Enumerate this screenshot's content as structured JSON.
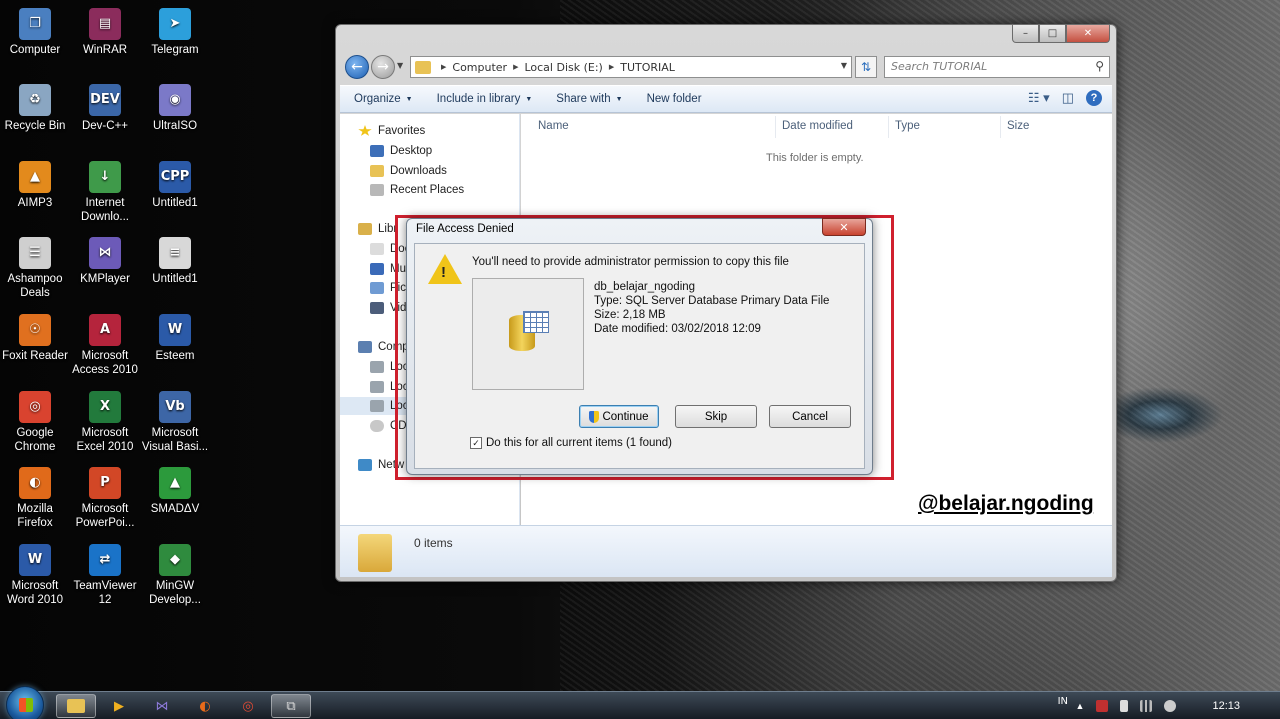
{
  "desktop": {
    "icons": [
      {
        "label": "Computer",
        "icon": "computer-icon",
        "color": "#4a7fc0",
        "glyph": "❐"
      },
      {
        "label": "WinRAR",
        "icon": "winrar-icon",
        "color": "#8b2c5c",
        "glyph": "▤"
      },
      {
        "label": "Telegram",
        "icon": "telegram-icon",
        "color": "#2c9fdb",
        "glyph": "➤"
      },
      {
        "label": "Recycle Bin",
        "icon": "recycle-bin-icon",
        "color": "#8aa6c2",
        "glyph": "♻"
      },
      {
        "label": "Dev-C++",
        "icon": "devcpp-icon",
        "color": "#3b67a8",
        "glyph": "DEV"
      },
      {
        "label": "UltraISO",
        "icon": "ultraiso-icon",
        "color": "#7b79c8",
        "glyph": "◉"
      },
      {
        "label": "AIMP3",
        "icon": "aimp-icon",
        "color": "#e38a1c",
        "glyph": "▲"
      },
      {
        "label": "Internet\nDownlo...",
        "icon": "idm-icon",
        "color": "#3f9a4a",
        "glyph": "↓"
      },
      {
        "label": "Untitled1",
        "icon": "cpp-file-icon",
        "color": "#2b5aa8",
        "glyph": "CPP"
      },
      {
        "label": "Ashampoo\nDeals",
        "icon": "ashampoo-icon",
        "color": "#cfcfcf",
        "glyph": "☰"
      },
      {
        "label": "KMPlayer",
        "icon": "kmplayer-icon",
        "color": "#6c5ab8",
        "glyph": "⋈"
      },
      {
        "label": "Untitled1",
        "icon": "document-icon",
        "color": "#d8d8d8",
        "glyph": "≡"
      },
      {
        "label": "Foxit Reader",
        "icon": "foxit-icon",
        "color": "#e0701f",
        "glyph": "☉"
      },
      {
        "label": "Microsoft\nAccess 2010",
        "icon": "access-icon",
        "color": "#b5243c",
        "glyph": "A"
      },
      {
        "label": "Esteem",
        "icon": "word-doc-icon",
        "color": "#2b5aa8",
        "glyph": "W"
      },
      {
        "label": "Google\nChrome",
        "icon": "chrome-icon",
        "color": "#d9432f",
        "glyph": "◎"
      },
      {
        "label": "Microsoft\nExcel 2010",
        "icon": "excel-icon",
        "color": "#227a3c",
        "glyph": "X"
      },
      {
        "label": "Microsoft\nVisual Basi...",
        "icon": "visual-basic-icon",
        "color": "#3d66a6",
        "glyph": "Vb"
      },
      {
        "label": "Mozilla\nFirefox",
        "icon": "firefox-icon",
        "color": "#e06a1a",
        "glyph": "◐"
      },
      {
        "label": "Microsoft\nPowerPoi...",
        "icon": "powerpoint-icon",
        "color": "#d24726",
        "glyph": "P"
      },
      {
        "label": "SMADΔV",
        "icon": "smadav-icon",
        "color": "#2c9a3c",
        "glyph": "▲"
      },
      {
        "label": "Microsoft\nWord 2010",
        "icon": "word-icon",
        "color": "#2b5aa8",
        "glyph": "W"
      },
      {
        "label": "TeamViewer\n12",
        "icon": "teamviewer-icon",
        "color": "#1a73c8",
        "glyph": "⇄"
      },
      {
        "label": "MinGW\nDevelop...",
        "icon": "mingw-icon",
        "color": "#2f8b3e",
        "glyph": "◆"
      }
    ]
  },
  "explorer": {
    "window_buttons": {
      "minimize": "–",
      "maximize": "□",
      "close": "✕"
    },
    "breadcrumb": [
      "Computer",
      "Local Disk (E:)",
      "TUTORIAL"
    ],
    "search_placeholder": "Search TUTORIAL",
    "commands": {
      "organize": "Organize",
      "include_in_library": "Include in library",
      "share_with": "Share with",
      "new_folder": "New folder"
    },
    "nav": {
      "favorites": "Favorites",
      "desktop": "Desktop",
      "downloads": "Downloads",
      "recent_places": "Recent Places",
      "libraries": "Libr",
      "documents": "Doc",
      "music": "Mus",
      "pictures": "Pict",
      "videos": "Vide",
      "computer": "Comp",
      "local_disk_c": "Loc",
      "local_disk_d": "Loc",
      "local_disk_e": "Loc",
      "cd_drive": "CD",
      "network": "Netw"
    },
    "columns": {
      "name": "Name",
      "date_modified": "Date modified",
      "type": "Type",
      "size": "Size"
    },
    "empty_message": "This folder is empty.",
    "items_count": "0 items"
  },
  "dialog": {
    "title": "File Access Denied",
    "close_glyph": "✕",
    "message": "You'll need to provide administrator permission to copy this file",
    "file": {
      "name": "db_belajar_ngoding",
      "type": "Type: SQL Server Database Primary Data File",
      "size": "Size: 2,18 MB",
      "date_modified": "Date modified: 03/02/2018 12:09"
    },
    "buttons": {
      "continue": "Continue",
      "skip": "Skip",
      "cancel": "Cancel"
    },
    "checkbox_label": "Do this for all current items (1 found)",
    "checkbox_checked": true,
    "highlight_color": "#d0202e"
  },
  "watermark": "@belajar.ngoding",
  "taskbar": {
    "language": "IN",
    "clock": "12:13"
  }
}
